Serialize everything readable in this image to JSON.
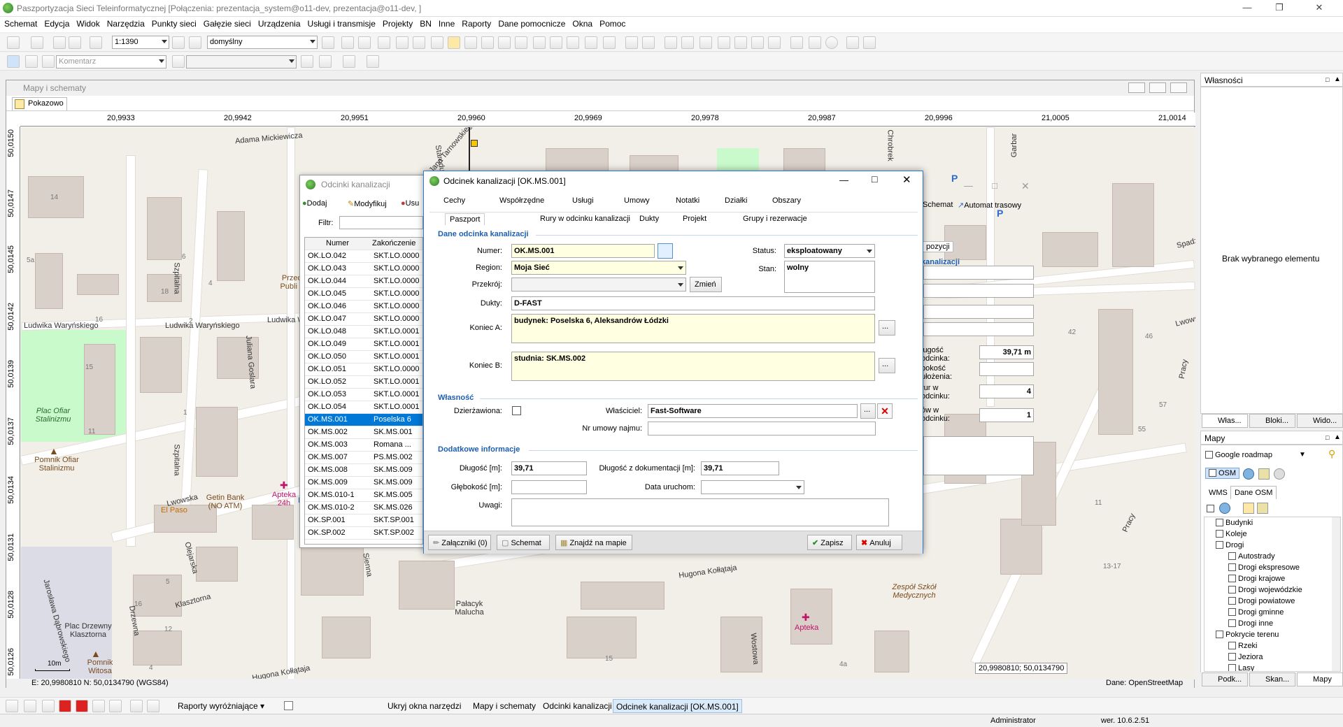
{
  "app": {
    "title": "Paszportyzacja Sieci Teleinformatycznej [Połączenia: prezentacja_system@o11-dev, prezentacja@o11-dev, ]"
  },
  "menu": [
    "Schemat",
    "Edycja",
    "Widok",
    "Narzędzia",
    "Punkty sieci",
    "Gałęzie sieci",
    "Urządzenia",
    "Usługi i transmisje",
    "Projekty",
    "BN",
    "Inne",
    "Raporty",
    "Dane pomocnicze",
    "Okna",
    "Pomoc"
  ],
  "toolbar": {
    "scale": "1:1390",
    "style": "domyślny",
    "comment_placeholder": "Komentarz"
  },
  "map_window": {
    "title": "Mapy i schematy",
    "tab": "Pokazowo",
    "x_ticks": [
      "20,9933",
      "20,9942",
      "20,9951",
      "20,9960",
      "20,9969",
      "20,9978",
      "20,9987",
      "20,9996",
      "21,0005",
      "21,0014"
    ],
    "y_ticks": [
      "50,0150",
      "50,0147",
      "50,0145",
      "50,0142",
      "50,0139",
      "50,0137",
      "50,0134",
      "50,0131",
      "50,0128",
      "50,0126"
    ],
    "coords_box": "20,9980810; 50,0134790",
    "status_left": "E: 20,9980810  N: 50,0134790 (WGS84)",
    "status_right": "Dane: OpenStreetMap",
    "scale_bar": "10m",
    "labels": {
      "mickiewicza": "Adama Mickiewicza",
      "hetmana": "Hetmana Jana Tarnowskiego",
      "starodubska": "Starodubska",
      "szpitalna1": "Szpitalna",
      "szpitalna2": "Szpitalna",
      "goslara": "Juliana Goslara",
      "warynskiego1": "Ludwika Waryńskiego",
      "warynskiego2": "Ludwika Waryńskiego",
      "warynskiego3": "Ludwika Waryńskiego",
      "plac_ofiar": "Plac Ofiar Stalinizmu",
      "pomnik_ofiar": "Pomnik Ofiar Stalinizmu",
      "lwowska1": "Lwowska",
      "lwowska2": "Lwowska",
      "elpaso": "El Paso",
      "getin": "Getin Bank (NO ATM)",
      "apteka1": "Apteka 24h",
      "apteka2": "Apteka",
      "olejarska": "Olejarska",
      "klasztorna": "Klasztorna",
      "drzewna": "Drzewna",
      "plac_drzewny": "Plac Drzewny Klasztorna",
      "dabrowskiego": "Jarosława Dąbrowskiego",
      "pomnik_witosa": "Pomnik Witosa",
      "hugona1": "Hugona Kołłątaja",
      "hugona2": "Hugona Kołłątaja",
      "palacyk": "Pałacyk Malucha",
      "sienna": "Sienna",
      "zespol": "Zespół Szkół Medycznych",
      "wostowa": "Wostowa",
      "pracy1": "Pracy",
      "pracy2": "Pracy",
      "spadz": "Spadz",
      "chrobrego": "Chrobrek",
      "garbarska": "Garbar",
      "przedszkole": "Przeds Publi Nr",
      "lw": "Lw"
    }
  },
  "odcinki_window": {
    "title": "Odcinki kanalizacji",
    "btn_add": "Dodaj",
    "btn_modify": "Modyfikuj",
    "btn_delete": "Usu",
    "filter_label": "Filtr:",
    "col_number": "Numer",
    "col_end": "Zakończenie",
    "btn_schemat": "Schemat",
    "btn_automat": "Automat trasowy",
    "tab_pozycji": "pozycji",
    "sect_kanalizacji": "kanalizacji",
    "lbl_dlugosc": "ługość odcinka:",
    "val_dlugosc": "39,71 m",
    "lbl_glebokosc": "bokość ułożenia:",
    "lbl_rur": "rur w odcinku:",
    "val_rur": "4",
    "lbl_dukt": "ów w odcinku:",
    "val_dukt": "1",
    "rows": [
      {
        "num": "OK.LO.042",
        "end": "SKT.LO.0000"
      },
      {
        "num": "OK.LO.043",
        "end": "SKT.LO.0000"
      },
      {
        "num": "OK.LO.044",
        "end": "SKT.LO.0000"
      },
      {
        "num": "OK.LO.045",
        "end": "SKT.LO.0000"
      },
      {
        "num": "OK.LO.046",
        "end": "SKT.LO.0000"
      },
      {
        "num": "OK.LO.047",
        "end": "SKT.LO.0000"
      },
      {
        "num": "OK.LO.048",
        "end": "SKT.LO.0001"
      },
      {
        "num": "OK.LO.049",
        "end": "SKT.LO.0001"
      },
      {
        "num": "OK.LO.050",
        "end": "SKT.LO.0001"
      },
      {
        "num": "OK.LO.051",
        "end": "SKT.LO.0000"
      },
      {
        "num": "OK.LO.052",
        "end": "SKT.LO.0001"
      },
      {
        "num": "OK.LO.053",
        "end": "SKT.LO.0001"
      },
      {
        "num": "OK.LO.054",
        "end": "SKT.LO.0001"
      },
      {
        "num": "OK.MS.001",
        "end": "Poselska 6"
      },
      {
        "num": "OK.MS.002",
        "end": "SK.MS.001"
      },
      {
        "num": "OK.MS.003",
        "end": "Romana ..."
      },
      {
        "num": "OK.MS.007",
        "end": "PS.MS.002"
      },
      {
        "num": "OK.MS.008",
        "end": "SK.MS.009"
      },
      {
        "num": "OK.MS.009",
        "end": "SK.MS.009"
      },
      {
        "num": "OK.MS.010-1",
        "end": "SK.MS.005"
      },
      {
        "num": "OK.MS.010-2",
        "end": "SK.MS.026"
      },
      {
        "num": "OK.SP.001",
        "end": "SKT.SP.001"
      },
      {
        "num": "OK.SP.002",
        "end": "SKT.SP.002"
      }
    ]
  },
  "dialog": {
    "title": "Odcinek kanalizacji [OK.MS.001]",
    "tabs_row1": [
      "Cechy",
      "Współrzędne",
      "Usługi",
      "Umowy",
      "Notatki",
      "Działki",
      "Obszary"
    ],
    "tabs_row2": [
      "Paszport",
      "Rury w odcinku kanalizacji",
      "Dukty",
      "Projekt",
      "Grupy i rezerwacje"
    ],
    "sect_dane": "Dane odcinka kanalizacji",
    "lbl_numer": "Numer:",
    "val_numer": "OK.MS.001",
    "lbl_region": "Region:",
    "val_region": "Moja Sieć",
    "lbl_przekroj": "Przekrój:",
    "btn_zmien": "Zmień",
    "lbl_dukty": "Dukty:",
    "val_dukty": "D-FAST",
    "lbl_konieca": "Koniec A:",
    "val_konieca": "budynek: Poselska 6, Aleksandrów Łódzki",
    "lbl_koniecb": "Koniec B:",
    "val_koniecb": "studnia: SK.MS.002",
    "lbl_status": "Status:",
    "val_status": "eksploatowany",
    "lbl_stan": "Stan:",
    "val_stan": "wolny",
    "sect_wlasnosc": "Własność",
    "lbl_dzierz": "Dzierżawiona:",
    "lbl_wlasciciel": "Właściciel:",
    "val_wlasciciel": "Fast-Software",
    "lbl_umowa": "Nr umowy najmu:",
    "sect_dodatkowe": "Dodatkowe informacje",
    "lbl_dlugosc": "Długość [m]:",
    "val_dlugosc": "39,71",
    "lbl_dlugosc_dok": "Długość z dokumentacji [m]:",
    "val_dlugosc_dok": "39,71",
    "lbl_glebokosc": "Głębokość [m]:",
    "lbl_data": "Data uruchom:",
    "lbl_uwagi": "Uwagi:",
    "btn_zalaczniki": "Załączniki (0)",
    "btn_schemat": "Schemat",
    "btn_znajdz": "Znajdź na mapie",
    "btn_zapisz": "Zapisz",
    "btn_anuluj": "Anuluj",
    "ellipsis": "..."
  },
  "right_panel": {
    "props_title": "Własności",
    "props_empty": "Brak wybranego elementu",
    "props_tabs": [
      "Włas...",
      "Bloki...",
      "Wido..."
    ],
    "maps_title": "Mapy",
    "google": "Google roadmap",
    "osm": "OSM",
    "wms": "WMS",
    "dane_osm": "Dane OSM",
    "tree": [
      {
        "label": "Budynki",
        "indent": 1
      },
      {
        "label": "Koleje",
        "indent": 1
      },
      {
        "label": "Drogi",
        "indent": 1
      },
      {
        "label": "Autostrady",
        "indent": 2
      },
      {
        "label": "Drogi ekspresowe",
        "indent": 2
      },
      {
        "label": "Drogi krajowe",
        "indent": 2
      },
      {
        "label": "Drogi wojewódzkie",
        "indent": 2
      },
      {
        "label": "Drogi powiatowe",
        "indent": 2
      },
      {
        "label": "Drogi gminne",
        "indent": 2
      },
      {
        "label": "Drogi inne",
        "indent": 2
      },
      {
        "label": "Pokrycie terenu",
        "indent": 1
      },
      {
        "label": "Rzeki",
        "indent": 2
      },
      {
        "label": "Jeziora",
        "indent": 2
      },
      {
        "label": "Lasy",
        "indent": 2
      }
    ],
    "bottom_tabs": [
      "Podk...",
      "Skan...",
      "Mapy"
    ]
  },
  "bottombar": {
    "reports": "Raporty wyróżniające",
    "hide_tools": "Ukryj okna narzędzi",
    "task1": "Mapy i schematy",
    "task2": "Odcinki kanalizacji",
    "task3": "Odcinek kanalizacji [OK.MS.001]"
  },
  "status": {
    "user": "Administrator",
    "version": "wer. 10.6.2.51"
  }
}
